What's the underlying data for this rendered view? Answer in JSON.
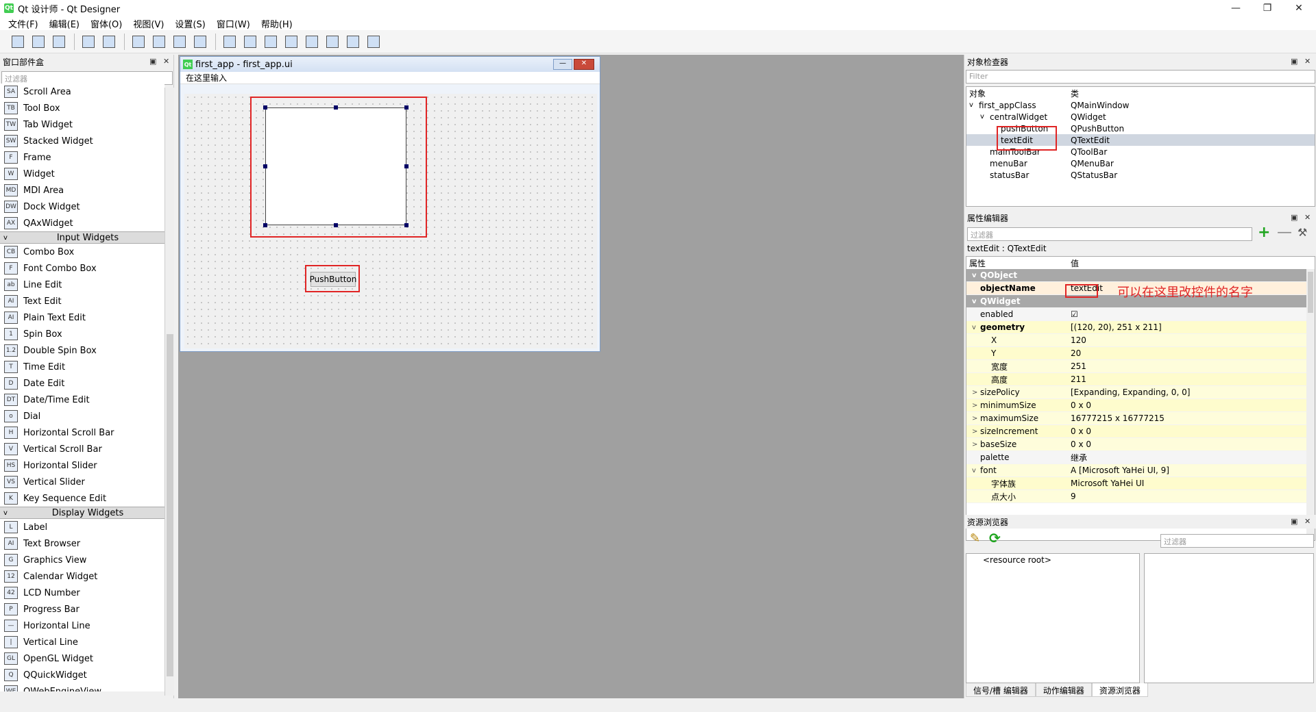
{
  "window": {
    "title": "Qt 设计师 - Qt Designer",
    "app_icon": "Qt"
  },
  "menubar": [
    "文件(F)",
    "编辑(E)",
    "窗体(O)",
    "视图(V)",
    "设置(S)",
    "窗口(W)",
    "帮助(H)"
  ],
  "toolbar_icons": [
    "new-icon",
    "open-icon",
    "save-icon",
    "sep",
    "bring-front-icon",
    "send-back-icon",
    "sep",
    "edit-widgets-icon",
    "edit-signals-icon",
    "edit-buddies-icon",
    "edit-tab-order-icon",
    "sep",
    "layout-horizontal-icon",
    "layout-vertical-icon",
    "layout-split-h-icon",
    "layout-split-v-icon",
    "layout-grid-icon",
    "layout-form-icon",
    "break-layout-icon",
    "adjust-size-icon"
  ],
  "widget_box": {
    "title": "窗口部件盒",
    "filter_placeholder": "过滤器",
    "items": [
      {
        "type": "item",
        "label": "Scroll Area",
        "icon": "SA"
      },
      {
        "type": "item",
        "label": "Tool Box",
        "icon": "TB"
      },
      {
        "type": "item",
        "label": "Tab Widget",
        "icon": "TW"
      },
      {
        "type": "item",
        "label": "Stacked Widget",
        "icon": "SW"
      },
      {
        "type": "item",
        "label": "Frame",
        "icon": "F"
      },
      {
        "type": "item",
        "label": "Widget",
        "icon": "W"
      },
      {
        "type": "item",
        "label": "MDI Area",
        "icon": "MD"
      },
      {
        "type": "item",
        "label": "Dock Widget",
        "icon": "DW"
      },
      {
        "type": "item",
        "label": "QAxWidget",
        "icon": "AX"
      },
      {
        "type": "cat",
        "label": "Input Widgets"
      },
      {
        "type": "item",
        "label": "Combo Box",
        "icon": "CB"
      },
      {
        "type": "item",
        "label": "Font Combo Box",
        "icon": "F"
      },
      {
        "type": "item",
        "label": "Line Edit",
        "icon": "ab"
      },
      {
        "type": "item",
        "label": "Text Edit",
        "icon": "AI"
      },
      {
        "type": "item",
        "label": "Plain Text Edit",
        "icon": "AI"
      },
      {
        "type": "item",
        "label": "Spin Box",
        "icon": "1"
      },
      {
        "type": "item",
        "label": "Double Spin Box",
        "icon": "1.2"
      },
      {
        "type": "item",
        "label": "Time Edit",
        "icon": "T"
      },
      {
        "type": "item",
        "label": "Date Edit",
        "icon": "D"
      },
      {
        "type": "item",
        "label": "Date/Time Edit",
        "icon": "DT"
      },
      {
        "type": "item",
        "label": "Dial",
        "icon": "o"
      },
      {
        "type": "item",
        "label": "Horizontal Scroll Bar",
        "icon": "H"
      },
      {
        "type": "item",
        "label": "Vertical Scroll Bar",
        "icon": "V"
      },
      {
        "type": "item",
        "label": "Horizontal Slider",
        "icon": "HS"
      },
      {
        "type": "item",
        "label": "Vertical Slider",
        "icon": "VS"
      },
      {
        "type": "item",
        "label": "Key Sequence Edit",
        "icon": "K"
      },
      {
        "type": "cat",
        "label": "Display Widgets"
      },
      {
        "type": "item",
        "label": "Label",
        "icon": "L"
      },
      {
        "type": "item",
        "label": "Text Browser",
        "icon": "AI"
      },
      {
        "type": "item",
        "label": "Graphics View",
        "icon": "G"
      },
      {
        "type": "item",
        "label": "Calendar Widget",
        "icon": "12"
      },
      {
        "type": "item",
        "label": "LCD Number",
        "icon": "42"
      },
      {
        "type": "item",
        "label": "Progress Bar",
        "icon": "P"
      },
      {
        "type": "item",
        "label": "Horizontal Line",
        "icon": "—"
      },
      {
        "type": "item",
        "label": "Vertical Line",
        "icon": "|"
      },
      {
        "type": "item",
        "label": "OpenGL Widget",
        "icon": "GL"
      },
      {
        "type": "item",
        "label": "QQuickWidget",
        "icon": "Q"
      },
      {
        "type": "item",
        "label": "QWebEngineView",
        "icon": "WE"
      }
    ]
  },
  "form": {
    "title": "first_app - first_app.ui",
    "menu_placeholder": "在这里输入",
    "push_button_label": "PushButton"
  },
  "object_inspector": {
    "title": "对象检查器",
    "filter_placeholder": "Filter",
    "col_object": "对象",
    "col_class": "类",
    "rows": [
      {
        "obj": "first_appClass",
        "cls": "QMainWindow",
        "level": 0,
        "exp": "v"
      },
      {
        "obj": "centralWidget",
        "cls": "QWidget",
        "level": 1,
        "exp": "v"
      },
      {
        "obj": "pushButton",
        "cls": "QPushButton",
        "level": 2,
        "exp": ""
      },
      {
        "obj": "textEdit",
        "cls": "QTextEdit",
        "level": 2,
        "exp": "",
        "selected": true
      },
      {
        "obj": "mainToolBar",
        "cls": "QToolBar",
        "level": 1,
        "exp": ""
      },
      {
        "obj": "menuBar",
        "cls": "QMenuBar",
        "level": 1,
        "exp": ""
      },
      {
        "obj": "statusBar",
        "cls": "QStatusBar",
        "level": 1,
        "exp": ""
      }
    ]
  },
  "property_editor": {
    "title": "属性编辑器",
    "filter_placeholder": "过滤器",
    "object_label": "textEdit : QTextEdit",
    "col_prop": "属性",
    "col_value": "值",
    "annotation": "可以在这里改控件的名字",
    "rows": [
      {
        "kind": "group",
        "name": "QObject",
        "value": ""
      },
      {
        "kind": "bold",
        "name": "objectName",
        "value": "textEdit"
      },
      {
        "kind": "group",
        "name": "QWidget",
        "value": ""
      },
      {
        "kind": "plain",
        "name": "enabled",
        "value": "☑"
      },
      {
        "kind": "bold",
        "name": "geometry",
        "value": "[(120, 20), 251 x 211]",
        "exp": "v"
      },
      {
        "kind": "sub",
        "name": "X",
        "value": "120"
      },
      {
        "kind": "sub",
        "name": "Y",
        "value": "20"
      },
      {
        "kind": "sub",
        "name": "宽度",
        "value": "251"
      },
      {
        "kind": "sub",
        "name": "高度",
        "value": "211"
      },
      {
        "kind": "plain",
        "name": "sizePolicy",
        "value": "[Expanding, Expanding, 0, 0]",
        "exp": ">"
      },
      {
        "kind": "plain",
        "name": "minimumSize",
        "value": "0 x 0",
        "exp": ">"
      },
      {
        "kind": "plain",
        "name": "maximumSize",
        "value": "16777215 x 16777215",
        "exp": ">"
      },
      {
        "kind": "plain",
        "name": "sizeIncrement",
        "value": "0 x 0",
        "exp": ">"
      },
      {
        "kind": "plain",
        "name": "baseSize",
        "value": "0 x 0",
        "exp": ">"
      },
      {
        "kind": "plain",
        "name": "palette",
        "value": "继承"
      },
      {
        "kind": "plain",
        "name": "font",
        "value": "A  [Microsoft YaHei UI, 9]",
        "exp": "v"
      },
      {
        "kind": "sub",
        "name": "字体族",
        "value": "Microsoft YaHei UI"
      },
      {
        "kind": "sub",
        "name": "点大小",
        "value": "9"
      }
    ]
  },
  "resource_browser": {
    "title": "资源浏览器",
    "filter_placeholder": "过滤器",
    "root": "<resource root>",
    "tabs": [
      "信号/槽 编辑器",
      "动作编辑器",
      "资源浏览器"
    ]
  }
}
